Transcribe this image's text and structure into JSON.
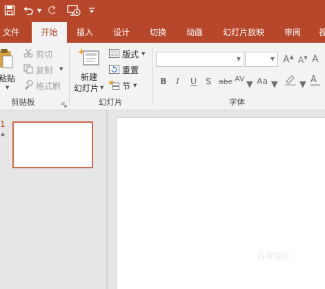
{
  "qat": {
    "save_icon": "save-icon",
    "undo_icon": "undo-icon",
    "redo_icon": "redo-icon",
    "present_icon": "start-from-beginning-icon",
    "customize_icon": "customize-qat-icon"
  },
  "tabs": [
    {
      "label": "文件"
    },
    {
      "label": "开始"
    },
    {
      "label": "插入"
    },
    {
      "label": "设计"
    },
    {
      "label": "切换"
    },
    {
      "label": "动画"
    },
    {
      "label": "幻灯片放映"
    },
    {
      "label": "审阅"
    },
    {
      "label": "视"
    }
  ],
  "active_tab": "开始",
  "clipboard": {
    "paste_label": "粘贴",
    "cut_label": "剪切",
    "copy_label": "复制",
    "format_painter_label": "格式刷",
    "group_label": "剪贴板"
  },
  "slides_group": {
    "new_slide_line1": "新建",
    "new_slide_line2": "幻灯片",
    "layout_label": "版式",
    "reset_label": "重置",
    "section_label": "节",
    "group_label": "幻灯片"
  },
  "font_group": {
    "font_name_value": "",
    "font_size_value": "",
    "bold": "B",
    "italic": "I",
    "underline": "U",
    "shadow": "S",
    "strikethrough": "abc",
    "char_spacing": "AV",
    "change_case": "Aa",
    "clear_formatting": "A",
    "font_color": "A",
    "grow_font": "A",
    "shrink_font": "A",
    "group_label": "字体"
  },
  "slide_panel": {
    "slide_number": "1",
    "transition_marker": "★"
  },
  "watermark": "百度经验",
  "colors": {
    "accent": "#b7472a",
    "ribbon_bg": "#f3f3f3",
    "workspace_bg": "#e6e6e6",
    "thumb_border": "#d2694a"
  }
}
